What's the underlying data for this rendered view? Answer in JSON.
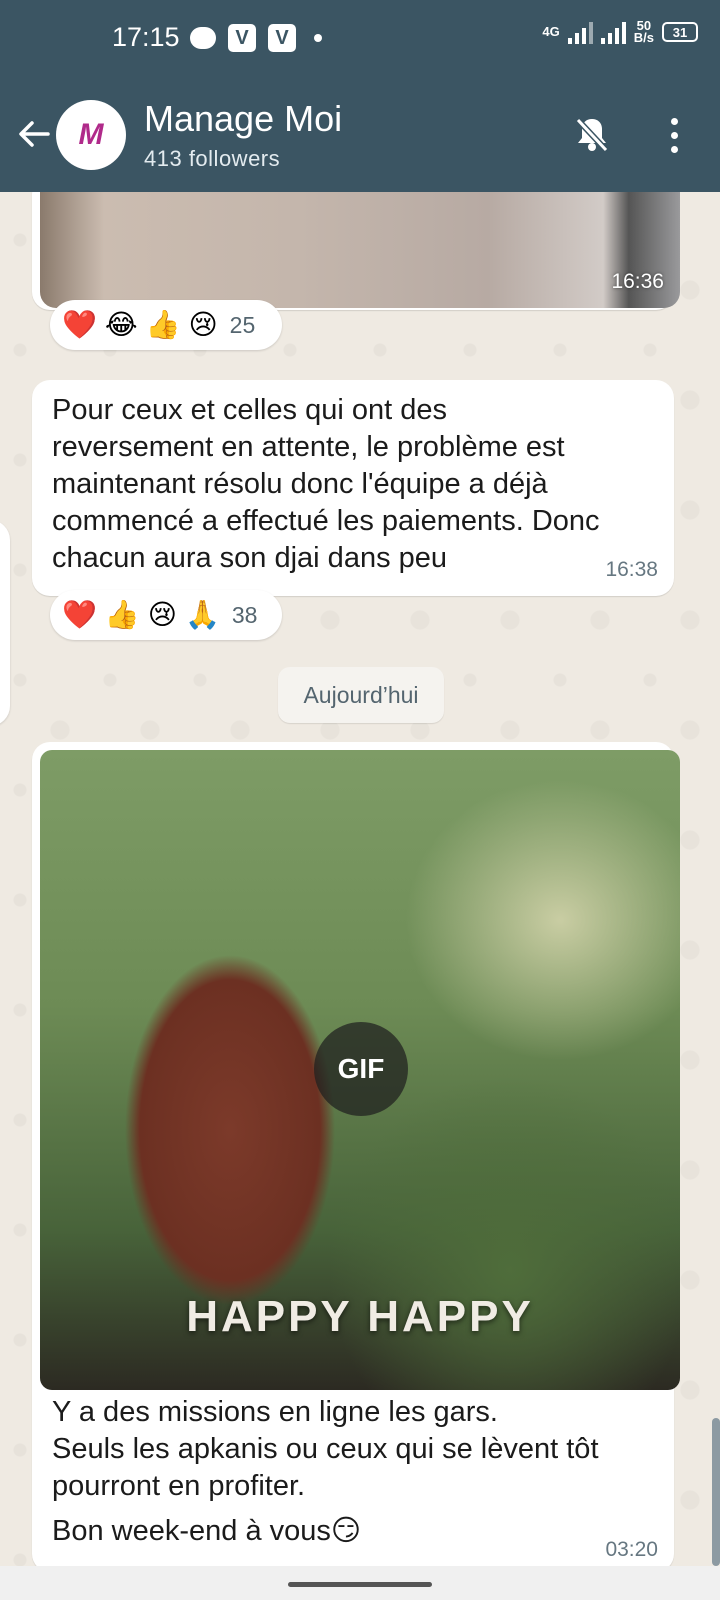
{
  "status_bar": {
    "time": "17:15",
    "network": "4G",
    "speed_value": "50",
    "speed_unit": "B/s",
    "battery": "31"
  },
  "header": {
    "title": "Manage Moi",
    "subtitle": "413 followers",
    "avatar_icon": "channel-logo",
    "back_icon": "arrow-left-icon",
    "mute_icon": "bell-off-icon",
    "menu_icon": "more-vertical-icon"
  },
  "messages": [
    {
      "type": "image",
      "time": "16:36",
      "reactions": [
        "❤️",
        "😂",
        "👍",
        "😢"
      ],
      "reaction_count": "25"
    },
    {
      "type": "text",
      "lines": [
        "Pour ceux et celles qui ont des",
        "reversement en attente, le problème est",
        "maintenant résolu donc l'équipe a déjà",
        "commencé a effectué les paiements. Donc",
        "chacun aura son djai dans peu"
      ],
      "time": "16:38",
      "reactions": [
        "❤️",
        "👍",
        "😢",
        "🙏"
      ],
      "reaction_count": "38"
    },
    {
      "type": "gif",
      "gif_label": "GIF",
      "gif_caption": "HAPPY HAPPY",
      "lines": [
        "Y a des missions en ligne les gars.",
        "Seuls les apkanis ou ceux qui se lèvent tôt",
        "pourront en profiter.",
        "Bon week-end à vous😏"
      ],
      "time": "03:20"
    }
  ],
  "date_divider": "Aujourd’hui",
  "colors": {
    "header_bg": "#3b5563",
    "chat_bg": "#efeae2",
    "bubble_bg": "#ffffff",
    "time_text": "#667781"
  }
}
